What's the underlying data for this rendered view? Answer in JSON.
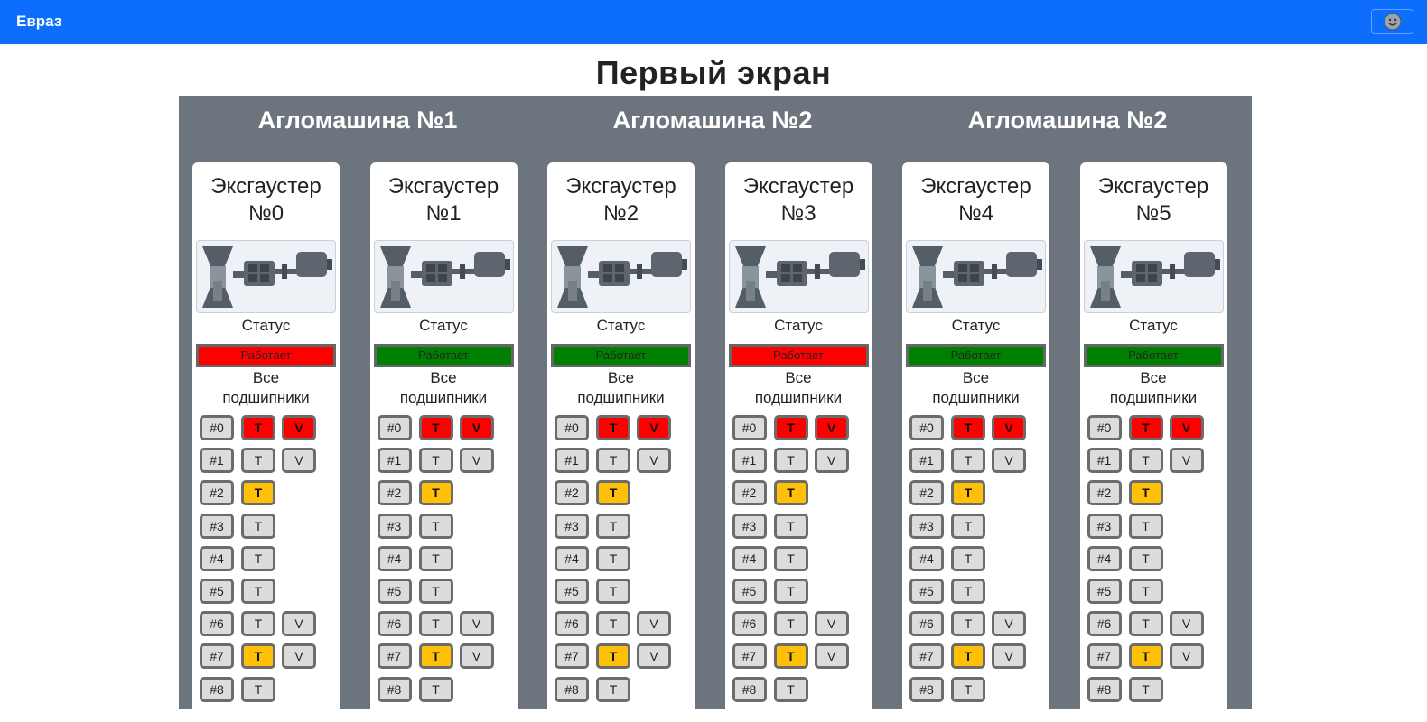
{
  "navbar": {
    "brand": "Евраз",
    "avatar_icon": "smiley-avatar-icon"
  },
  "page_title": "Первый экран",
  "machines": [
    {
      "title": "Агломашина №1"
    },
    {
      "title": "Агломашина №2"
    },
    {
      "title": "Агломашина №2"
    }
  ],
  "labels": {
    "status": "Статус",
    "all_bearings_1": "Все",
    "all_bearings_2": "подшипники"
  },
  "colors": {
    "red": "#ff0000",
    "green": "#008000",
    "yellow": "#ffc107",
    "gray": "#dcdcdc",
    "panel": "#6c757d",
    "navbar": "#0d6efd"
  },
  "exhausters": [
    {
      "line1": "Эксгаустер",
      "line2": "№0",
      "status": "Работает",
      "status_color": "red"
    },
    {
      "line1": "Эксгаустер",
      "line2": "№1",
      "status": "Работает",
      "status_color": "green"
    },
    {
      "line1": "Эксгаустер",
      "line2": "№2",
      "status": "Работает",
      "status_color": "green"
    },
    {
      "line1": "Эксгаустер",
      "line2": "№3",
      "status": "Работает",
      "status_color": "red"
    },
    {
      "line1": "Эксгаустер",
      "line2": "№4",
      "status": "Работает",
      "status_color": "green"
    },
    {
      "line1": "Эксгаустер",
      "line2": "№5",
      "status": "Работает",
      "status_color": "green"
    }
  ],
  "bearings": [
    {
      "num": "#0",
      "t": "T",
      "t_state": "red",
      "v": "V",
      "v_state": "red"
    },
    {
      "num": "#1",
      "t": "T",
      "t_state": "gray",
      "v": "V",
      "v_state": "gray"
    },
    {
      "num": "#2",
      "t": "T",
      "t_state": "yellow",
      "v": "",
      "v_state": ""
    },
    {
      "num": "#3",
      "t": "T",
      "t_state": "gray",
      "v": "",
      "v_state": ""
    },
    {
      "num": "#4",
      "t": "T",
      "t_state": "gray",
      "v": "",
      "v_state": ""
    },
    {
      "num": "#5",
      "t": "T",
      "t_state": "gray",
      "v": "",
      "v_state": ""
    },
    {
      "num": "#6",
      "t": "T",
      "t_state": "gray",
      "v": "V",
      "v_state": "gray"
    },
    {
      "num": "#7",
      "t": "T",
      "t_state": "yellow",
      "v": "V",
      "v_state": "gray"
    },
    {
      "num": "#8",
      "t": "T",
      "t_state": "gray",
      "v": "",
      "v_state": ""
    }
  ]
}
